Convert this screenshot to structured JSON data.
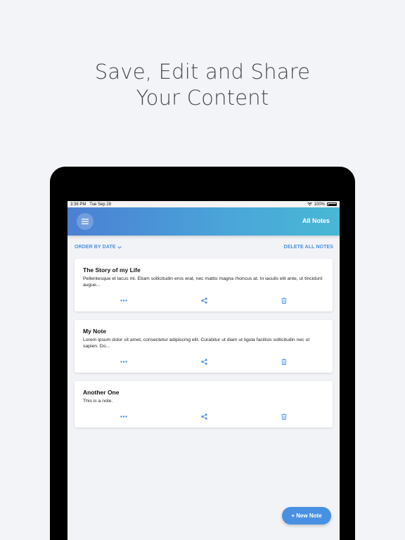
{
  "headline": {
    "line1": "Save, Edit and Share",
    "line2": "Your Content"
  },
  "status_bar": {
    "time": "3:36 PM",
    "date": "Tue Sep 28",
    "battery": "100%"
  },
  "app_bar": {
    "title": "All Notes",
    "menu_icon": "hamburger-icon"
  },
  "toolbar": {
    "order_label": "ORDER BY DATE",
    "delete_all_label": "DELETE ALL NOTES"
  },
  "notes": [
    {
      "title": "The Story of my Life",
      "body": "Pellentesque et lacus mi. Etiam sollicitudin eros erat, nec mattis magna rhoncus at. In iaculis elit ante, ut tincidunt augue..."
    },
    {
      "title": "My Note",
      "body": "Lorem ipsum dolor sit amet, consectetur adipiscing elit. Curabitur ut diam ut ligula facilisis sollicitudin nec ut sapien. Do..."
    },
    {
      "title": "Another One",
      "body": "This is a note."
    }
  ],
  "fab": {
    "label": "+ New Note"
  },
  "colors": {
    "accent": "#4a90e2",
    "appbar_start": "#4b7fd3",
    "appbar_end": "#48b8d4"
  }
}
